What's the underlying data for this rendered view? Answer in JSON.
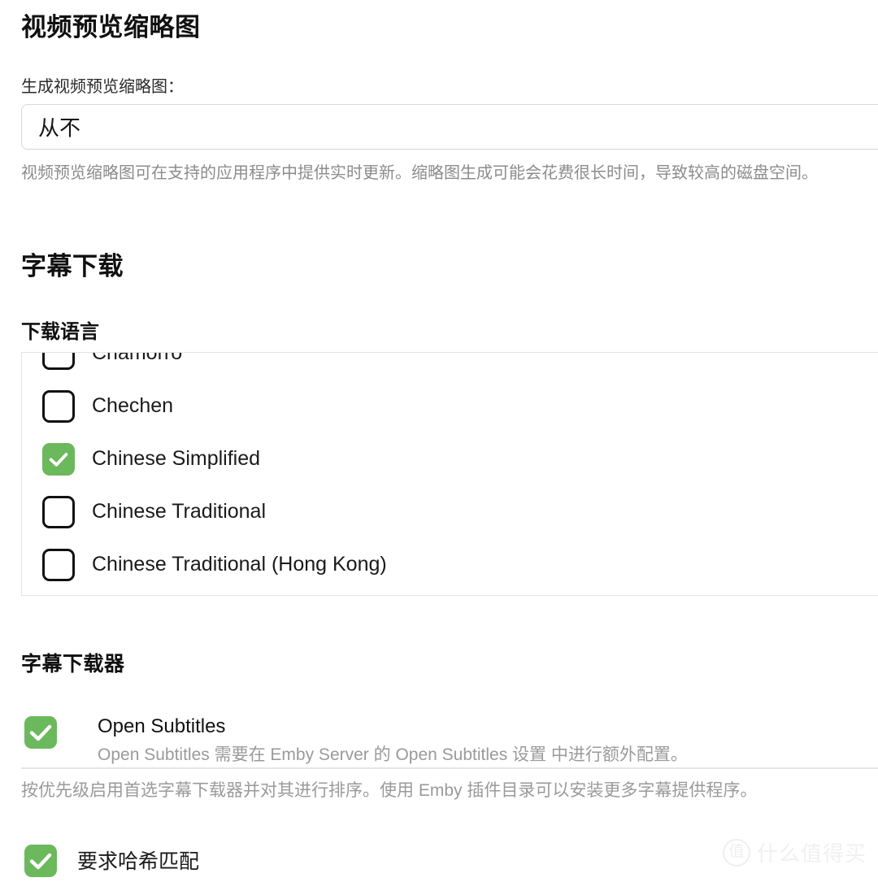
{
  "video_thumbnails": {
    "section_title": "视频预览缩略图",
    "field_label": "生成视频预览缩略图：",
    "select_value": "从不",
    "select_options": [
      "从不"
    ],
    "description": "视频预览缩略图可在支持的应用程序中提供实时更新。缩略图生成可能会花费很长时间，导致较高的磁盘空间。"
  },
  "subtitle_download": {
    "section_title": "字幕下载",
    "language_heading": "下载语言",
    "languages": [
      {
        "label": "Chamorro",
        "checked": false
      },
      {
        "label": "Chechen",
        "checked": false
      },
      {
        "label": "Chinese Simplified",
        "checked": true
      },
      {
        "label": "Chinese Traditional",
        "checked": false
      },
      {
        "label": "Chinese Traditional (Hong Kong)",
        "checked": false
      }
    ]
  },
  "subtitle_downloader": {
    "section_title": "字幕下载器",
    "providers": [
      {
        "name": "Open Subtitles",
        "description": "Open Subtitles 需要在 Emby Server 的 Open Subtitles 设置 中进行额外配置。",
        "checked": true
      }
    ],
    "footer_description": "按优先级启用首选字幕下载器并对其进行排序。使用 Emby 插件目录可以安装更多字幕提供程序。",
    "require_hash_match": {
      "label": "要求哈希匹配",
      "checked": true
    }
  },
  "watermark": {
    "badge": "值",
    "text": "什么值得买"
  },
  "colors": {
    "accent_green": "#6cb85d",
    "text_primary": "#1a1a1a",
    "text_muted": "#9a9a9a",
    "border": "#e3e3e3",
    "background": "#ffffff"
  }
}
